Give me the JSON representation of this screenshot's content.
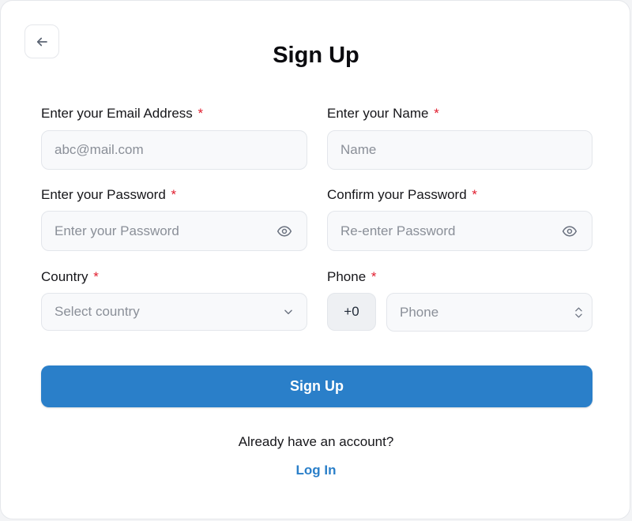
{
  "page": {
    "title": "Sign Up"
  },
  "form": {
    "email": {
      "label": "Enter your Email Address",
      "required_mark": "*",
      "placeholder": "abc@mail.com",
      "value": ""
    },
    "name": {
      "label": "Enter your Name",
      "required_mark": "*",
      "placeholder": "Name",
      "value": ""
    },
    "password": {
      "label": "Enter your Password",
      "required_mark": "*",
      "placeholder": "Enter your Password",
      "value": ""
    },
    "confirm_password": {
      "label": "Confirm your Password",
      "required_mark": "*",
      "placeholder": "Re-enter Password",
      "value": ""
    },
    "country": {
      "label": "Country",
      "required_mark": "*",
      "selected": "Select country"
    },
    "phone": {
      "label": "Phone",
      "required_mark": "*",
      "prefix": "+0",
      "placeholder": "Phone",
      "value": ""
    },
    "submit_label": "Sign Up"
  },
  "footer": {
    "prompt": "Already have an account?",
    "login_label": "Log In"
  },
  "icons": {
    "back": "arrow-left-icon",
    "password_toggle": "eye-icon",
    "confirm_toggle": "eye-icon",
    "country_dropdown": "chevron-down-icon",
    "phone_stepper": "stepper-icon"
  },
  "colors": {
    "accent": "#2a7fc9",
    "required": "#e11d2e",
    "input_bg": "#f8f9fb",
    "prefix_bg": "#eef0f3"
  }
}
